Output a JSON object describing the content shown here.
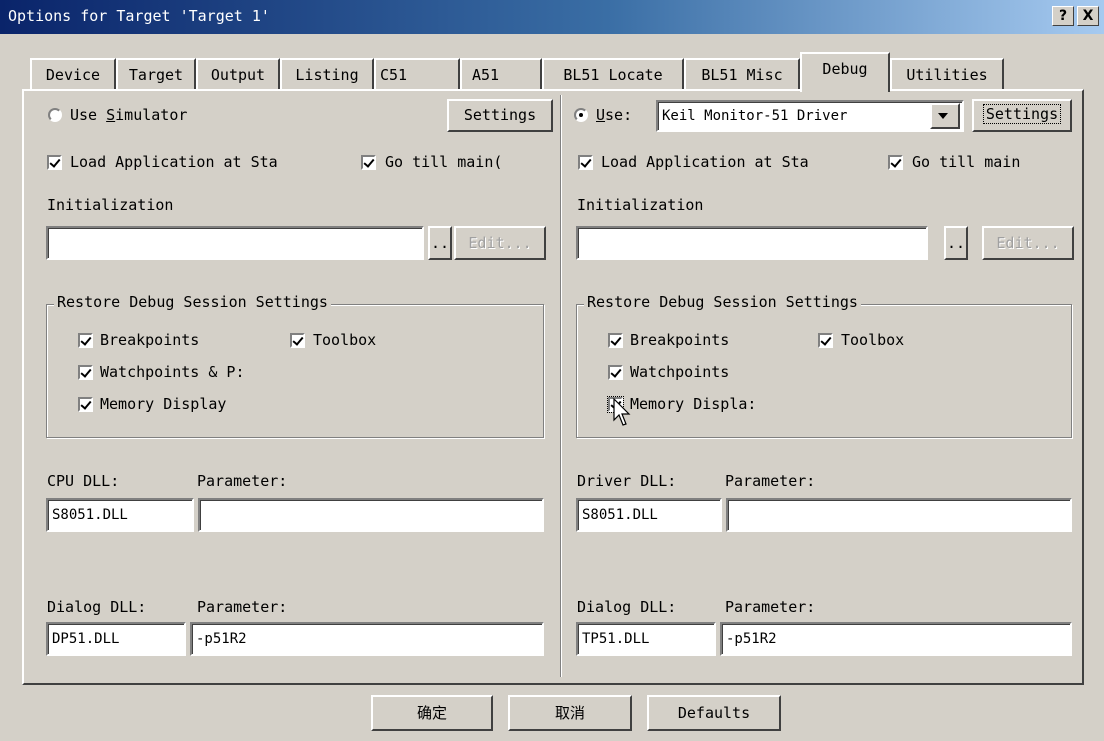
{
  "window": {
    "title": "Options for Target 'Target 1'",
    "help_glyph": "?",
    "close_glyph": "X"
  },
  "tabs": [
    "Device",
    "Target",
    "Output",
    "Listing",
    "C51",
    "A51",
    "BL51 Locate",
    "BL51 Misc",
    "Debug",
    "Utilities"
  ],
  "active_tab": "Debug",
  "left": {
    "mode_prefix": "Use ",
    "mode_access": "S",
    "mode_rest": "imulator",
    "selected": false,
    "settings_label": "Settings",
    "load_app_label": "Load Application at Sta",
    "go_main_label": "Go  till main(",
    "init_label": "Initialization",
    "init_value": "",
    "browse_label": "..",
    "edit_label": "Edit...",
    "restore_title": "Restore Debug Session Settings",
    "restore_items": {
      "breakpoints": "Breakpoints",
      "toolbox": "Toolbox",
      "watchpoints": "Watchpoints & P:",
      "memory": "Memory Display"
    },
    "cpu_dll_label": "CPU DLL:",
    "cpu_param_label": "Parameter:",
    "cpu_dll_value": "S8051.DLL",
    "cpu_param_value": "",
    "dialog_dll_label": "Dialog DLL:",
    "dialog_param_label": "Parameter:",
    "dialog_dll_value": "DP51.DLL",
    "dialog_param_value": "-p51R2"
  },
  "right": {
    "use_access": "U",
    "use_rest": "se:",
    "selected": true,
    "driver_value": "Keil Monitor-51 Driver",
    "settings_label": "Settings",
    "load_app_label": "Load Application at Sta",
    "go_main_label": "Go  till main",
    "init_label": "Initialization",
    "init_value": "",
    "browse_label": "..",
    "edit_label": "Edit...",
    "restore_title": "Restore Debug Session Settings",
    "restore_items": {
      "breakpoints": "Breakpoints",
      "toolbox": "Toolbox",
      "watchpoints": "Watchpoints",
      "memory": "Memory Displa:"
    },
    "driver_dll_label": "Driver DLL:",
    "driver_param_label": "Parameter:",
    "driver_dll_value": "S8051.DLL",
    "driver_param_value": "",
    "dialog_dll_label": "Dialog DLL:",
    "dialog_param_label": "Parameter:",
    "dialog_dll_value": "TP51.DLL",
    "dialog_param_value": "-p51R2"
  },
  "footer": {
    "ok_label": "确定",
    "cancel_label": "取消",
    "defaults_label": "Defaults"
  }
}
